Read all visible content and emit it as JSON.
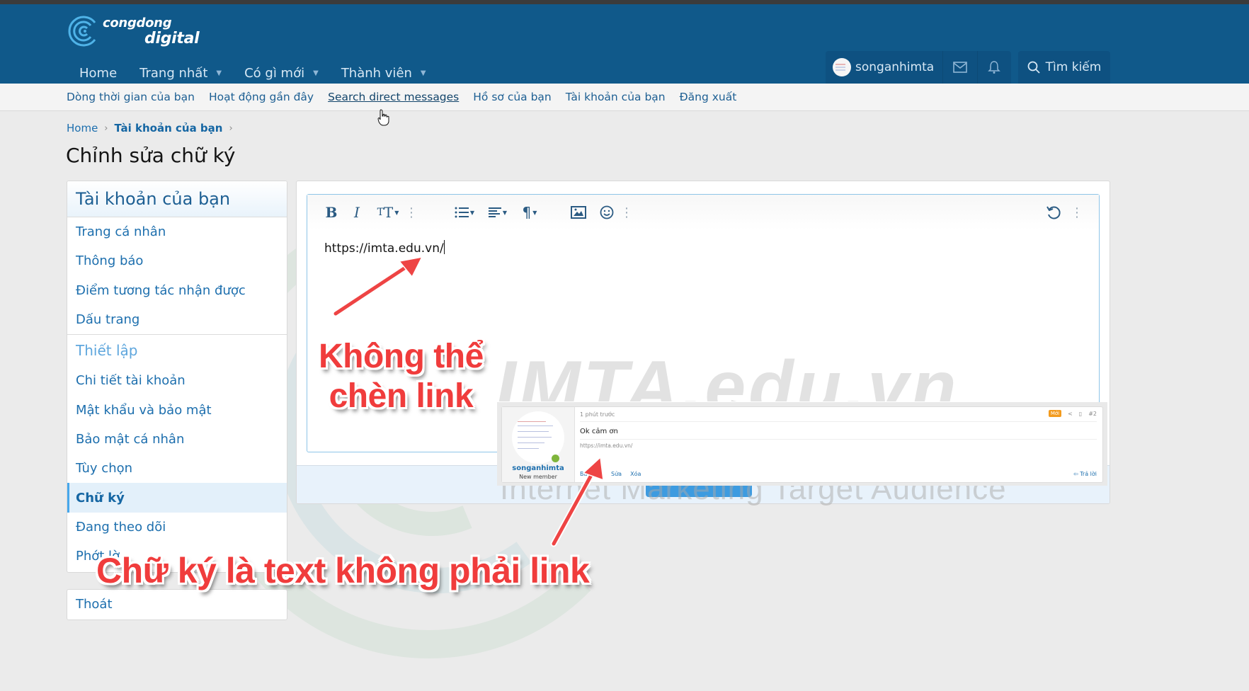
{
  "header": {
    "logo": {
      "line1": "congdong",
      "line2": "digital"
    },
    "nav": [
      {
        "label": "Home",
        "has_dropdown": false
      },
      {
        "label": "Trang nhất",
        "has_dropdown": true
      },
      {
        "label": "Có gì mới",
        "has_dropdown": true
      },
      {
        "label": "Thành viên",
        "has_dropdown": true
      }
    ],
    "user": {
      "name": "songanhimta",
      "icons": [
        "envelope-icon",
        "bell-icon"
      ]
    },
    "search_label": "Tìm kiếm"
  },
  "subnav": [
    {
      "label": "Dòng thời gian của bạn"
    },
    {
      "label": "Hoạt động gần đây"
    },
    {
      "label": "Search direct messages",
      "hovered": true
    },
    {
      "label": "Hồ sơ của bạn"
    },
    {
      "label": "Tài khoản của bạn"
    },
    {
      "label": "Đăng xuất"
    }
  ],
  "breadcrumb": [
    {
      "label": "Home"
    },
    {
      "label": "Tài khoản của bạn"
    }
  ],
  "page_title": "Chỉnh sửa chữ ký",
  "sidebar": {
    "title": "Tài khoản của bạn",
    "items": [
      {
        "label": "Trang cá nhân"
      },
      {
        "label": "Thông báo"
      },
      {
        "label": "Điểm tương tác nhận được"
      },
      {
        "label": "Dấu trang"
      }
    ],
    "section": "Thiết lập",
    "settings_items": [
      {
        "label": "Chi tiết tài khoản"
      },
      {
        "label": "Mật khẩu và bảo mật"
      },
      {
        "label": "Bảo mật cá nhân"
      },
      {
        "label": "Tùy chọn"
      },
      {
        "label": "Chữ ký",
        "active": true
      },
      {
        "label": "Đang theo dõi"
      },
      {
        "label": "Phớt lờ"
      }
    ],
    "logout": "Thoát"
  },
  "editor": {
    "toolbar": [
      "bold-icon",
      "italic-icon",
      "font-size-icon",
      "more-icon",
      "list-icon",
      "align-icon",
      "paragraph-icon",
      "image-icon",
      "emoji-icon",
      "more-icon",
      "undo-icon",
      "more-icon"
    ],
    "content": "https://imta.edu.vn/"
  },
  "watermark": {
    "main": "IMTA.edu.vn",
    "sub": "Internet Marketing Target Audience"
  },
  "post_preview": {
    "time": "1 phút trước",
    "badge": "Mới",
    "post_number": "#2",
    "message": "Ok cảm ơn",
    "signature": "https://imta.edu.vn/",
    "username": "songanhimta",
    "role": "New member",
    "actions": [
      "Báo cáo",
      "Sửa",
      "Xóa"
    ],
    "reply": "Trả lời"
  },
  "annotations": {
    "a1_line1": "Không thể",
    "a1_line2": "chèn link",
    "a2": "Chữ ký là text không phải link"
  },
  "colors": {
    "header_bg": "#10598a",
    "link": "#1d6fae",
    "annotation": "#f03c3c",
    "badge_new": "#f39b1e"
  }
}
